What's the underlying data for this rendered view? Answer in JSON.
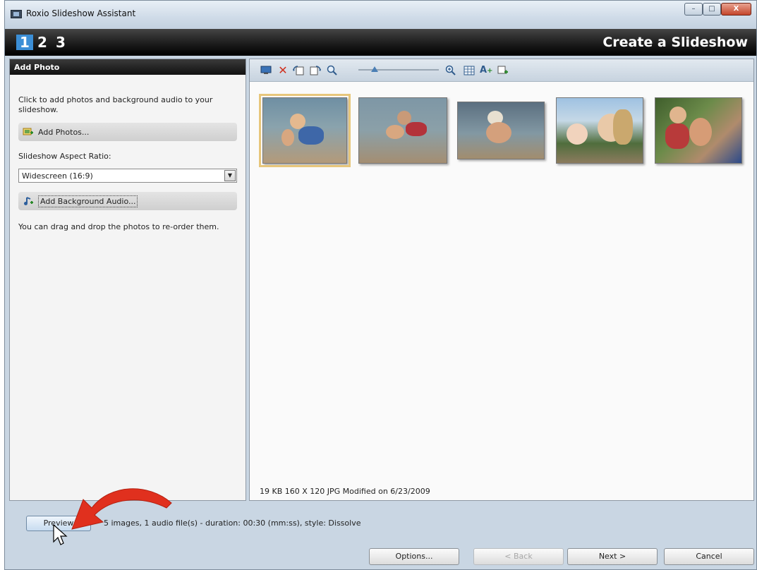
{
  "window": {
    "title": "Roxio Slideshow Assistant",
    "controls": {
      "minimize": "–",
      "maximize": "□",
      "close": "X"
    }
  },
  "steps": {
    "items": [
      "1",
      "2",
      "3"
    ],
    "active": "1",
    "page_title": "Create a Slideshow"
  },
  "left_panel": {
    "header": "Add Photo",
    "intro": "Click to add photos and background audio to your slideshow.",
    "add_photos_label": "Add Photos...",
    "aspect_ratio_label": "Slideshow Aspect Ratio:",
    "aspect_ratio_value": "Widescreen (16:9)",
    "add_audio_label": "Add Background Audio...",
    "drag_tip": "You can drag and drop the photos to re-order them."
  },
  "toolbar": {
    "icons": [
      "monitor-icon",
      "delete-icon",
      "rotate-left-icon",
      "rotate-right-icon",
      "zoom-icon",
      "zoom-slider",
      "fit-icon",
      "grid-icon",
      "text-icon",
      "add-icon"
    ]
  },
  "photos": {
    "items": [
      "photo-1",
      "photo-2",
      "photo-3",
      "photo-4",
      "photo-5"
    ],
    "selected_index": 0,
    "file_info": "19 KB   160 X 120   JPG   Modified on 6/23/2009"
  },
  "footer": {
    "preview_label": "Preview",
    "summary": "5 images,  1 audio file(s) - duration: 00:30 (mm:ss), style: Dissolve",
    "options_label": "Options...",
    "back_label": "< Back",
    "next_label": "Next >",
    "cancel_label": "Cancel"
  },
  "colors": {
    "accent_step": "#3b8ed6",
    "annotation_arrow": "#e0301e",
    "selected_outline": "#e7c67b"
  }
}
